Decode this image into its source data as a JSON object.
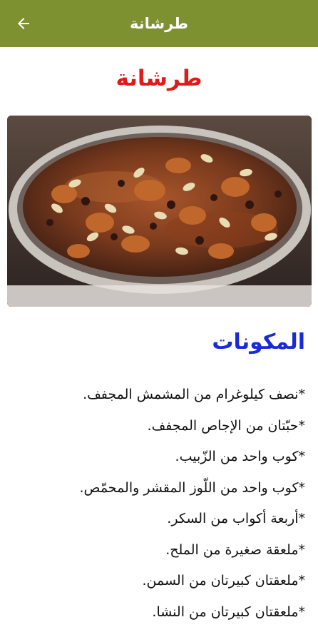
{
  "appbar": {
    "title": "طرشانة",
    "back_icon": "arrow-left-icon",
    "color": "#7e9130"
  },
  "page": {
    "title": "طرشانة",
    "title_color": "#e01919"
  },
  "ingredients_section": {
    "heading": "المكونات",
    "heading_color": "#1a2bd6",
    "items": [
      "*نصف كيلوغرام من المشمش المجفف.",
      "*حبّتان من الإجاص المجفف.",
      "*كوب واحد من الزّبيب.",
      "*كوب واحد من اللّوز المقشر والمحمّص.",
      "*أربعة أكواب من السكر.",
      "*ملعقة صغيرة من الملح.",
      "*ملعقتان كبيرتان من السمن.",
      "*ملعقتان كبيرتان من النشا."
    ]
  }
}
